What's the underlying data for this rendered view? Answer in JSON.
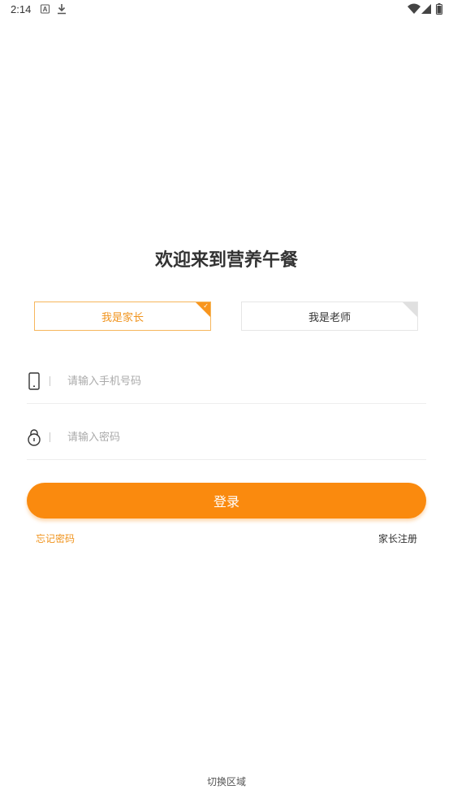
{
  "status_bar": {
    "time": "2:14",
    "icons": [
      "a-badge-icon",
      "download-icon",
      "wifi-icon",
      "signal-icon",
      "battery-icon"
    ]
  },
  "title": "欢迎来到营养午餐",
  "roles": {
    "parent_label": "我是家长",
    "teacher_label": "我是老师",
    "selected": "parent"
  },
  "phone_field": {
    "value": "",
    "placeholder": "请输入手机号码"
  },
  "password_field": {
    "value": "",
    "placeholder": "请输入密码"
  },
  "login_button": "登录",
  "forgot_password": "忘记密码",
  "parent_register": "家长注册",
  "switch_region": "切换区域",
  "colors": {
    "accent": "#fa8a0e",
    "accent_text": "#f0931c",
    "border_active": "#f6b65c"
  }
}
